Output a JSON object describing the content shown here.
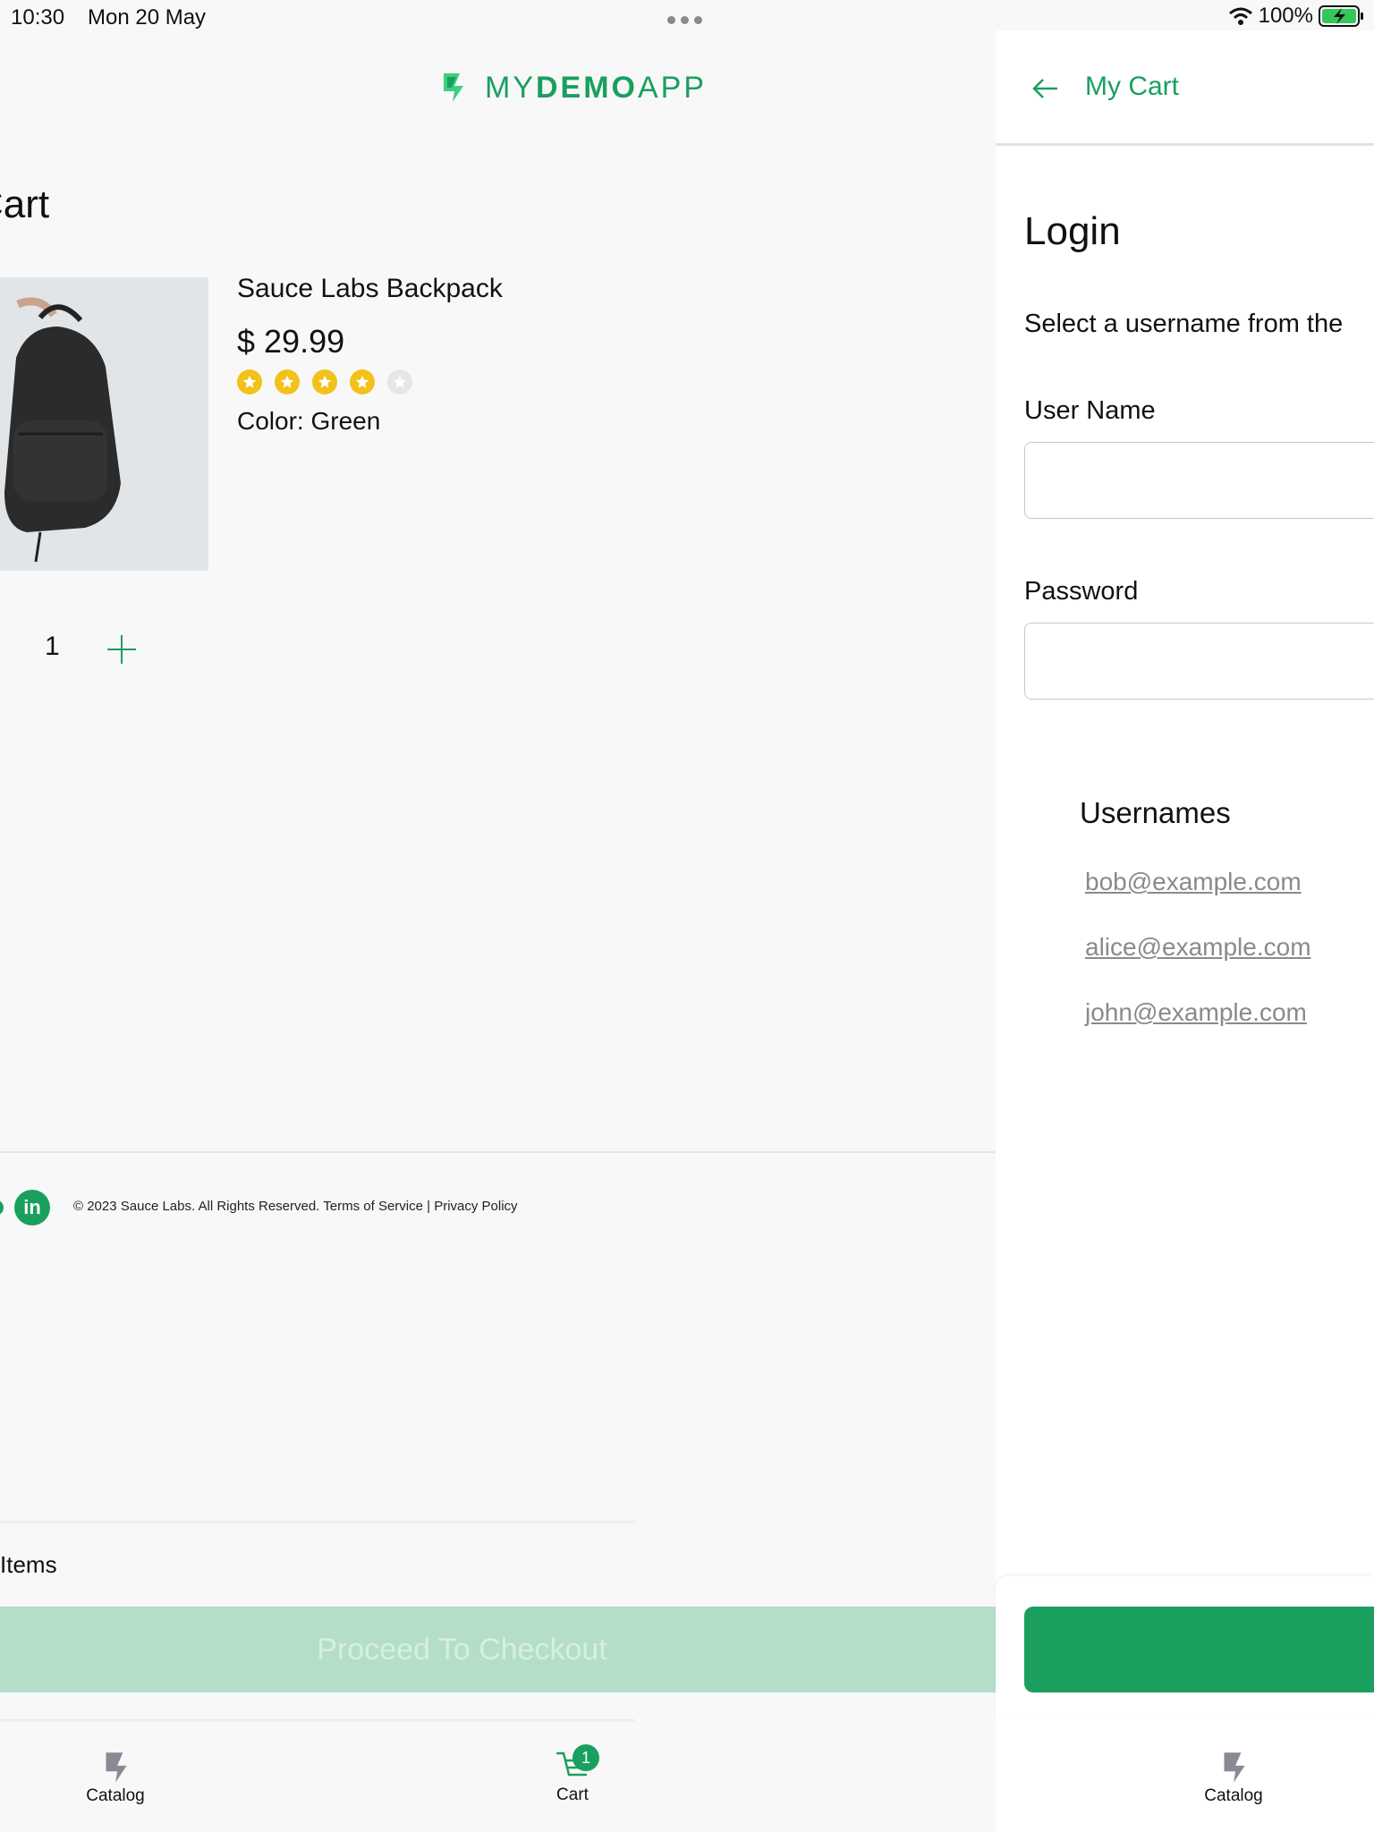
{
  "status_bar": {
    "time": "10:30",
    "date": "Mon 20 May",
    "battery": "100%"
  },
  "brand": {
    "logo_prefix": "MY",
    "logo_bold": "DEMO",
    "logo_suffix": "APP",
    "accent_color": "#1a9f5f"
  },
  "cart": {
    "title": "Cart",
    "item": {
      "name": "Sauce Labs Backpack",
      "price": "$ 29.99",
      "rating": 4,
      "rating_max": 5,
      "color_label": "Color:",
      "color_value": "Green",
      "quantity": "1"
    },
    "items_label": "Items",
    "checkout_label": "Proceed To Checkout"
  },
  "footer": {
    "linkedin": "in",
    "copyright": "© 2023 Sauce Labs. All Rights Reserved. Terms of Service | Privacy Policy"
  },
  "tabs": {
    "catalog": "Catalog",
    "cart": "Cart",
    "cart_badge": "1"
  },
  "login_panel": {
    "header_title": "My Cart",
    "title": "Login",
    "instructions": "Select a username from the",
    "user_label": "User Name",
    "user_value": "",
    "password_label": "Password",
    "password_value": "",
    "usernames_title": "Usernames",
    "usernames": [
      "bob@example.com",
      "alice@example.com",
      "john@example.com"
    ]
  }
}
